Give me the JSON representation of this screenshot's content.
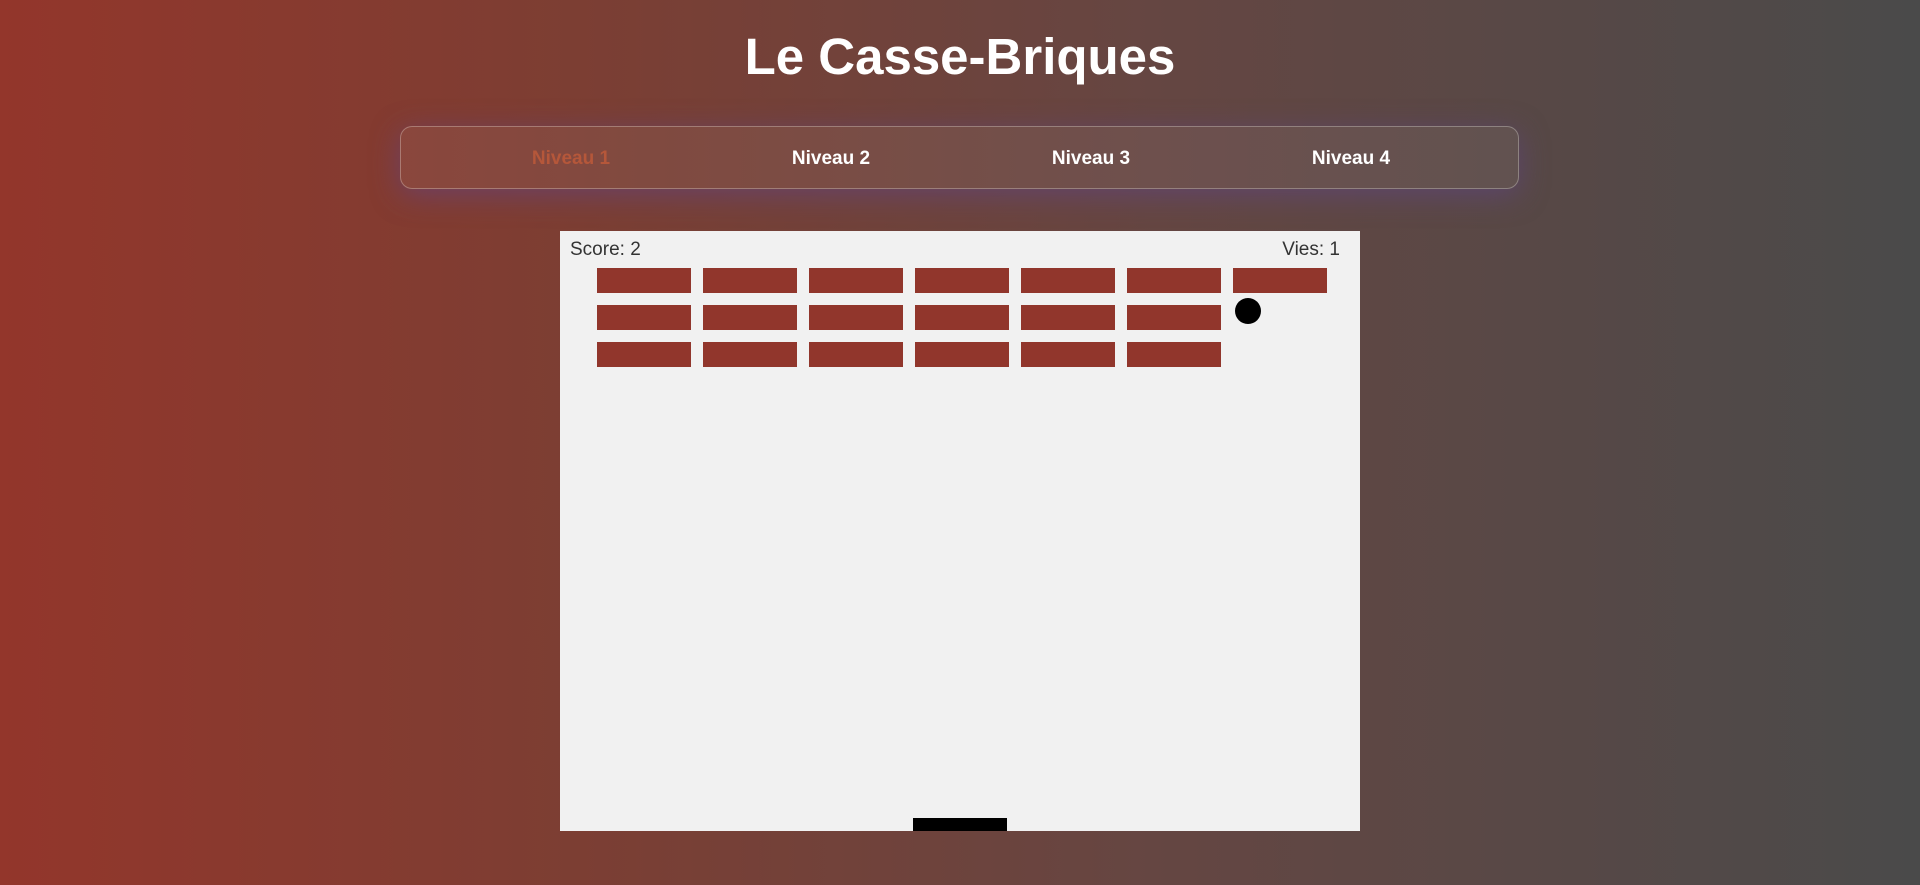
{
  "page": {
    "title": "Le Casse-Briques"
  },
  "levels": [
    {
      "label": "Niveau 1",
      "active": true
    },
    {
      "label": "Niveau 2",
      "active": false
    },
    {
      "label": "Niveau 3",
      "active": false
    },
    {
      "label": "Niveau 4",
      "active": false
    }
  ],
  "game": {
    "score_text": "Score: 2",
    "lives_text": "Vies: 1",
    "score": 2,
    "lives": 1,
    "brick_rows": 3,
    "brick_columns": 7,
    "bricks_remaining": [
      [
        true,
        true,
        true,
        true,
        true,
        true,
        true
      ],
      [
        true,
        true,
        true,
        true,
        true,
        true,
        false
      ],
      [
        true,
        true,
        true,
        true,
        true,
        true,
        false
      ]
    ]
  },
  "colors": {
    "accent": "#b5573a",
    "brick": "#91362c",
    "canvas_bg": "#f1f1f1",
    "ball": "#000000",
    "paddle": "#000000"
  }
}
